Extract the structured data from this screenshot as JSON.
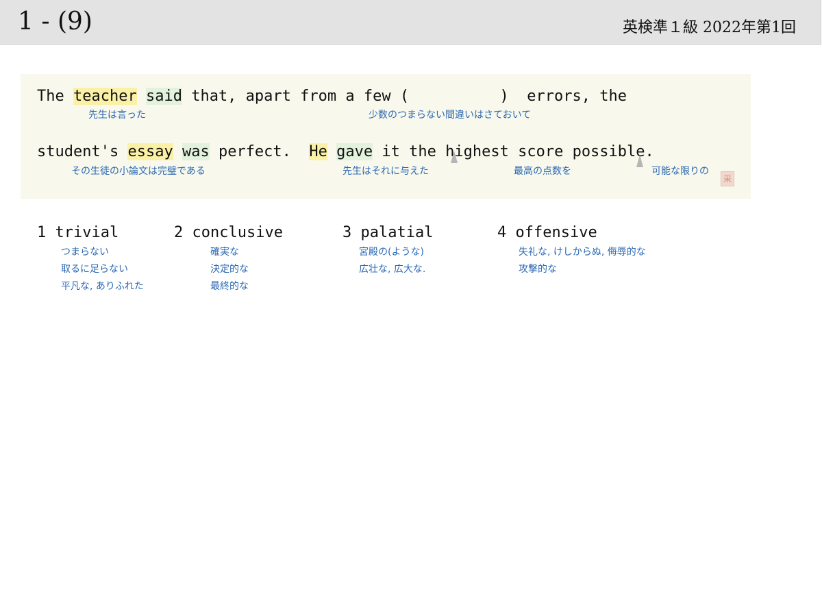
{
  "header": {
    "question_number": "1 - (9)",
    "exam_title": "英検準１級  2022年第1回"
  },
  "sentence": {
    "line1": {
      "the": "The",
      "teacher": "teacher",
      "said": "said",
      "rest": "that, apart from a few (          )  errors, the"
    },
    "line2": {
      "students": "student's",
      "essay": "essay",
      "was": "was",
      "perfect": "perfect.",
      "he": "He",
      "gave": "gave",
      "it": "it",
      "rest": "the highest score possible."
    },
    "glosses": {
      "teacher_said": "先生は言った",
      "few_errors": "少数のつまらない間違いはさておいて",
      "essay_was": "その生徒の小論文は完璧である",
      "he_gave": "先生はそれに与えた",
      "highest_score": "最高の点数を",
      "possible": "可能な限りの"
    },
    "seal_text": "采"
  },
  "choices": [
    {
      "label": "1 trivial",
      "meanings": [
        "つまらない",
        "取るに足らない",
        "平凡な, ありふれた"
      ]
    },
    {
      "label": "2 conclusive",
      "meanings": [
        "確実な",
        "決定的な",
        "最終的な"
      ]
    },
    {
      "label": "3 palatial",
      "meanings": [
        "宮殿の(ような)",
        "広壮な, 広大な."
      ]
    },
    {
      "label": "4 offensive",
      "meanings": [
        "失礼な, けしからぬ, 侮辱的な",
        "攻撃的な"
      ]
    }
  ]
}
